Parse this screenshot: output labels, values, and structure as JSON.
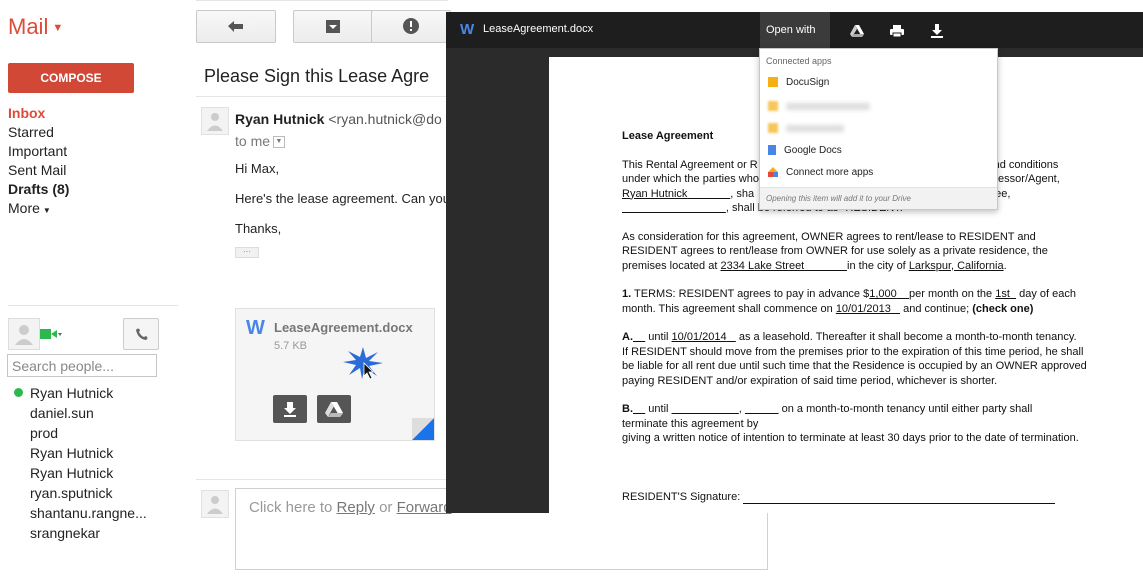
{
  "app": {
    "brand": "Mail"
  },
  "compose_label": "COMPOSE",
  "nav": {
    "inbox": "Inbox",
    "starred": "Starred",
    "important": "Important",
    "sent": "Sent Mail",
    "drafts": "Drafts (8)",
    "more": "More"
  },
  "people": {
    "search_placeholder": "Search people...",
    "contacts": [
      "Ryan Hutnick",
      "daniel.sun",
      "prod",
      "Ryan Hutnick",
      "Ryan Hutnick",
      "ryan.sputnick",
      "shantanu.rangne...",
      "srangnekar"
    ]
  },
  "email": {
    "subject": "Please Sign this Lease Agre",
    "sender_name": "Ryan Hutnick",
    "sender_email": "<ryan.hutnick@do",
    "to": "to me",
    "lines": [
      "Hi Max,",
      "Here's the lease agreement. Can you",
      "Thanks,"
    ],
    "attachment": {
      "name": "LeaseAgreement.docx",
      "size": "5.7 KB",
      "icon": "W"
    }
  },
  "reply": {
    "prefix": "Click here to",
    "reply": "Reply",
    "or": "or",
    "forward": "Forward"
  },
  "viewer": {
    "title": "LeaseAgreement.docx",
    "icon_letter": "W",
    "open_with": "Open with",
    "menu": {
      "header": "Connected apps",
      "items": [
        "DocuSign",
        "Google Docs",
        "Connect more apps"
      ],
      "footer": "Opening this item will add it to your Drive"
    }
  },
  "doc": {
    "title": "Lease Agreement",
    "p1": [
      "This Rental Agreement or R",
      "ms and conditions",
      "under which the parties who",
      "ord/Lessor/Agent,",
      "Ryan Hutnick",
      ", sha",
      "ssee,",
      ", shall be referred to as \"RESIDENT.\""
    ],
    "p2": [
      "As consideration for this agreement, OWNER agrees to rent/lease to RESIDENT and",
      "RESIDENT agrees to rent/lease from OWNER for use solely as a private residence, the",
      "premises located at",
      "2334 Lake Street",
      "in the city of",
      "Larkspur, California",
      "."
    ],
    "p3": [
      "1.",
      "TERMS: RESIDENT agrees to pay in advance $",
      "1,000",
      "per month on the",
      "1st",
      "day of each",
      "month. This agreement shall commence on",
      "10/01/2013",
      "and continue;",
      "(check one)"
    ],
    "p4": [
      "A.",
      "until",
      "10/01/2014",
      "as a leasehold. Thereafter it shall become a month-to-month tenancy.",
      "If RESIDENT should move from the premises prior to the expiration of this time period, he shall",
      "be liable for all rent due until such time that the Residence is occupied by an OWNER approved",
      "paying RESIDENT and/or expiration of said time period, whichever is shorter."
    ],
    "p5": [
      "B.",
      "until",
      "on a month-to-month tenancy until either party shall",
      "terminate this agreement by",
      "giving a written notice of intention to terminate at least 30 days prior to the date of termination."
    ],
    "signature": "RESIDENT'S Signature:"
  },
  "colors": {
    "brand": "#dd4b39",
    "compose": "#d14836",
    "drive_blue": "#4a86e8",
    "online": "#2db84d"
  }
}
